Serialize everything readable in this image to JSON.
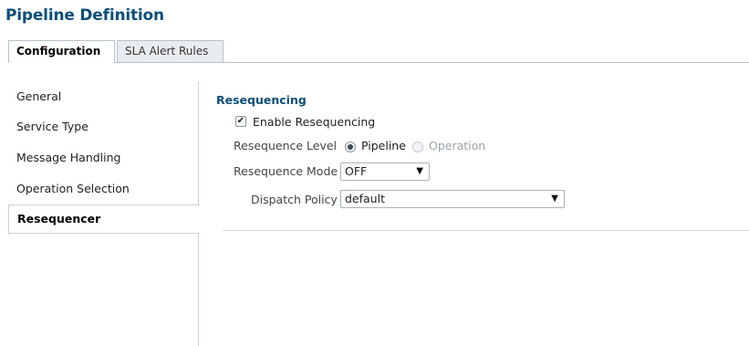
{
  "page": {
    "title": "Pipeline Definition"
  },
  "tabs": [
    {
      "label": "Configuration",
      "active": true
    },
    {
      "label": "SLA Alert Rules",
      "active": false
    }
  ],
  "sidebar": {
    "items": [
      {
        "label": "General"
      },
      {
        "label": "Service Type"
      },
      {
        "label": "Message Handling"
      },
      {
        "label": "Operation Selection"
      },
      {
        "label": "Resequencer",
        "selected": true
      }
    ]
  },
  "content": {
    "section_title": "Resequencing",
    "enable_checkbox": {
      "label": "Enable Resequencing",
      "checked": true,
      "mark": "✔"
    },
    "level": {
      "label": "Resequence Level",
      "options": [
        {
          "label": "Pipeline",
          "selected": true,
          "enabled": true
        },
        {
          "label": "Operation",
          "selected": false,
          "enabled": false
        }
      ]
    },
    "mode": {
      "label": "Resequence Mode",
      "value": "OFF"
    },
    "dispatch": {
      "label": "Dispatch Policy",
      "value": "default"
    }
  },
  "icons": {
    "dropdown": "▼"
  },
  "colors": {
    "title": "#0b4f78",
    "tab_inactive_bg": "#e9ecef",
    "border": "#b7c1c8"
  }
}
